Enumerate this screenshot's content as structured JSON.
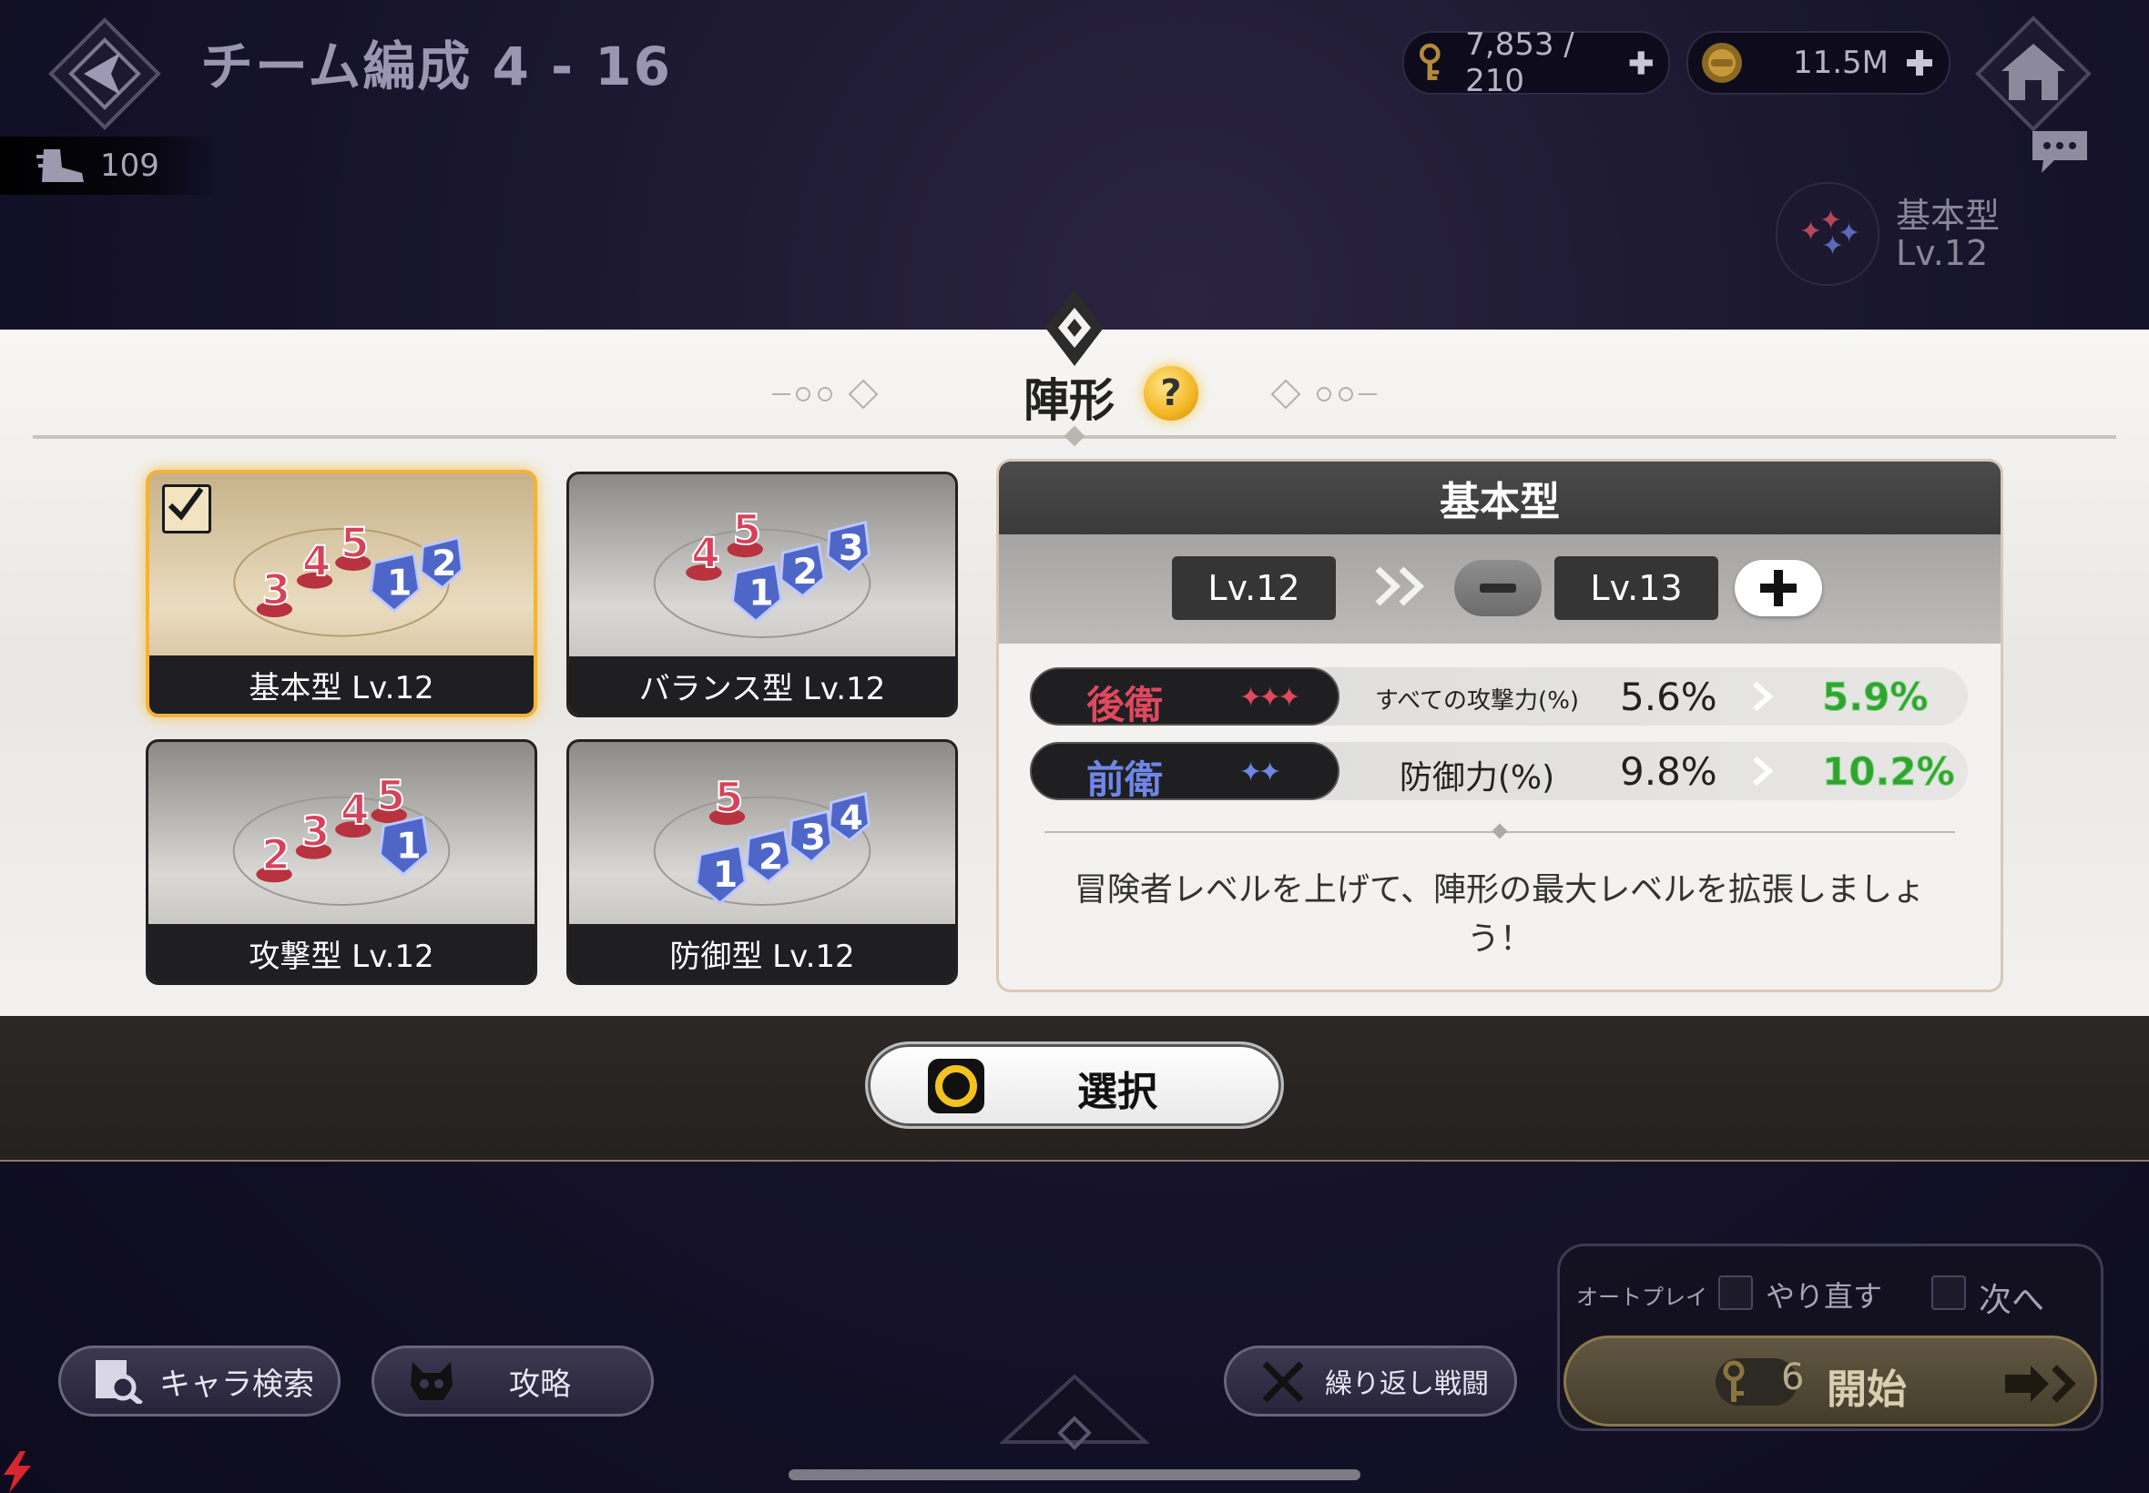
{
  "header": {
    "title": "チーム編成 4 - 16",
    "keys": "7,853 / 210",
    "gold": "11.5M",
    "stamina": "109",
    "side_formation_name": "基本型",
    "side_formation_level": "Lv.12",
    "icons": [
      "back-icon",
      "key-icon",
      "plus-icon",
      "gold-coin-icon",
      "home-icon",
      "stamina-boot-icon",
      "chat-icon"
    ]
  },
  "modal": {
    "title": "陣形",
    "help": "?",
    "formations": [
      {
        "label": "基本型 Lv.12",
        "selected": true
      },
      {
        "label": "バランス型 Lv.12",
        "selected": false
      },
      {
        "label": "攻撃型 Lv.12",
        "selected": false
      },
      {
        "label": "防御型 Lv.12",
        "selected": false
      }
    ],
    "detail": {
      "title": "基本型",
      "current_level": "Lv.12",
      "next_level": "Lv.13",
      "stats": [
        {
          "position": "後衛",
          "stars": "✦✦✦",
          "stat": "すべての攻撃力(%)",
          "current": "5.6%",
          "next": "5.9%",
          "color": "#e0485e",
          "star_color": "#e0485e"
        },
        {
          "position": "前衛",
          "stars": "✦✦",
          "stat": "防御力(%)",
          "current": "9.8%",
          "next": "10.2%",
          "color": "#6f86e8",
          "star_color": "#6f86e8"
        }
      ],
      "message": "冒険者レベルを上げて、陣形の最大レベルを拡張しましょう！"
    }
  },
  "actions": {
    "select_label": "選択"
  },
  "bottom": {
    "search_label": "キャラ検索",
    "guide_label": "攻略",
    "repeat_label": "繰り返し戦闘",
    "auto_label": "オートプレイ",
    "retry_label": "やり直す",
    "next_label": "次へ",
    "start_label": "開始",
    "start_cost": "6"
  },
  "colors": {
    "accent_gold": "#f2b33a",
    "increase_green": "#2fa52f",
    "back_red": "#e0485e",
    "front_blue": "#6f86e8"
  }
}
